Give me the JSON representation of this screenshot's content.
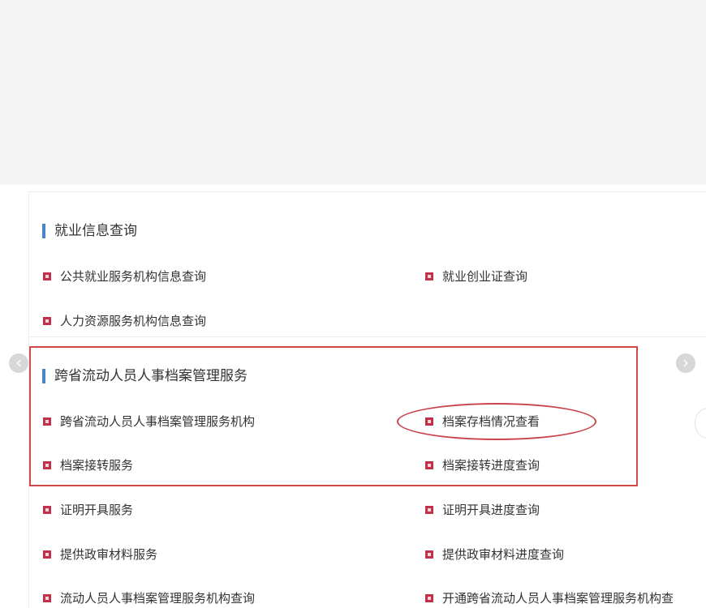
{
  "sections": [
    {
      "title": "就业信息查询",
      "items": [
        {
          "label": "公共就业服务机构信息查询"
        },
        {
          "label": "就业创业证查询"
        },
        {
          "label": "人力资源服务机构信息查询"
        }
      ]
    },
    {
      "title": "跨省流动人员人事档案管理服务",
      "items": [
        {
          "label": "跨省流动人员人事档案管理服务机构"
        },
        {
          "label": "档案存档情况查看"
        },
        {
          "label": "档案接转服务"
        },
        {
          "label": "档案接转进度查询"
        },
        {
          "label": "证明开具服务"
        },
        {
          "label": "证明开具进度查询"
        },
        {
          "label": "提供政审材料服务"
        },
        {
          "label": "提供政审材料进度查询"
        },
        {
          "label": "流动人员人事档案管理服务机构查询"
        },
        {
          "label": "开通跨省流动人员人事档案管理服务机构查"
        }
      ]
    }
  ],
  "carousel": {
    "prev_icon": "chevron-left-icon",
    "next_icon": "chevron-right-icon",
    "prev_glyph": "‹",
    "next_glyph": "›"
  },
  "annotation_colors": {
    "box": "#cf4b4b",
    "ellipse": "#c9434a",
    "bullet": "#c2304a",
    "title_bar": "#4a86c6"
  }
}
